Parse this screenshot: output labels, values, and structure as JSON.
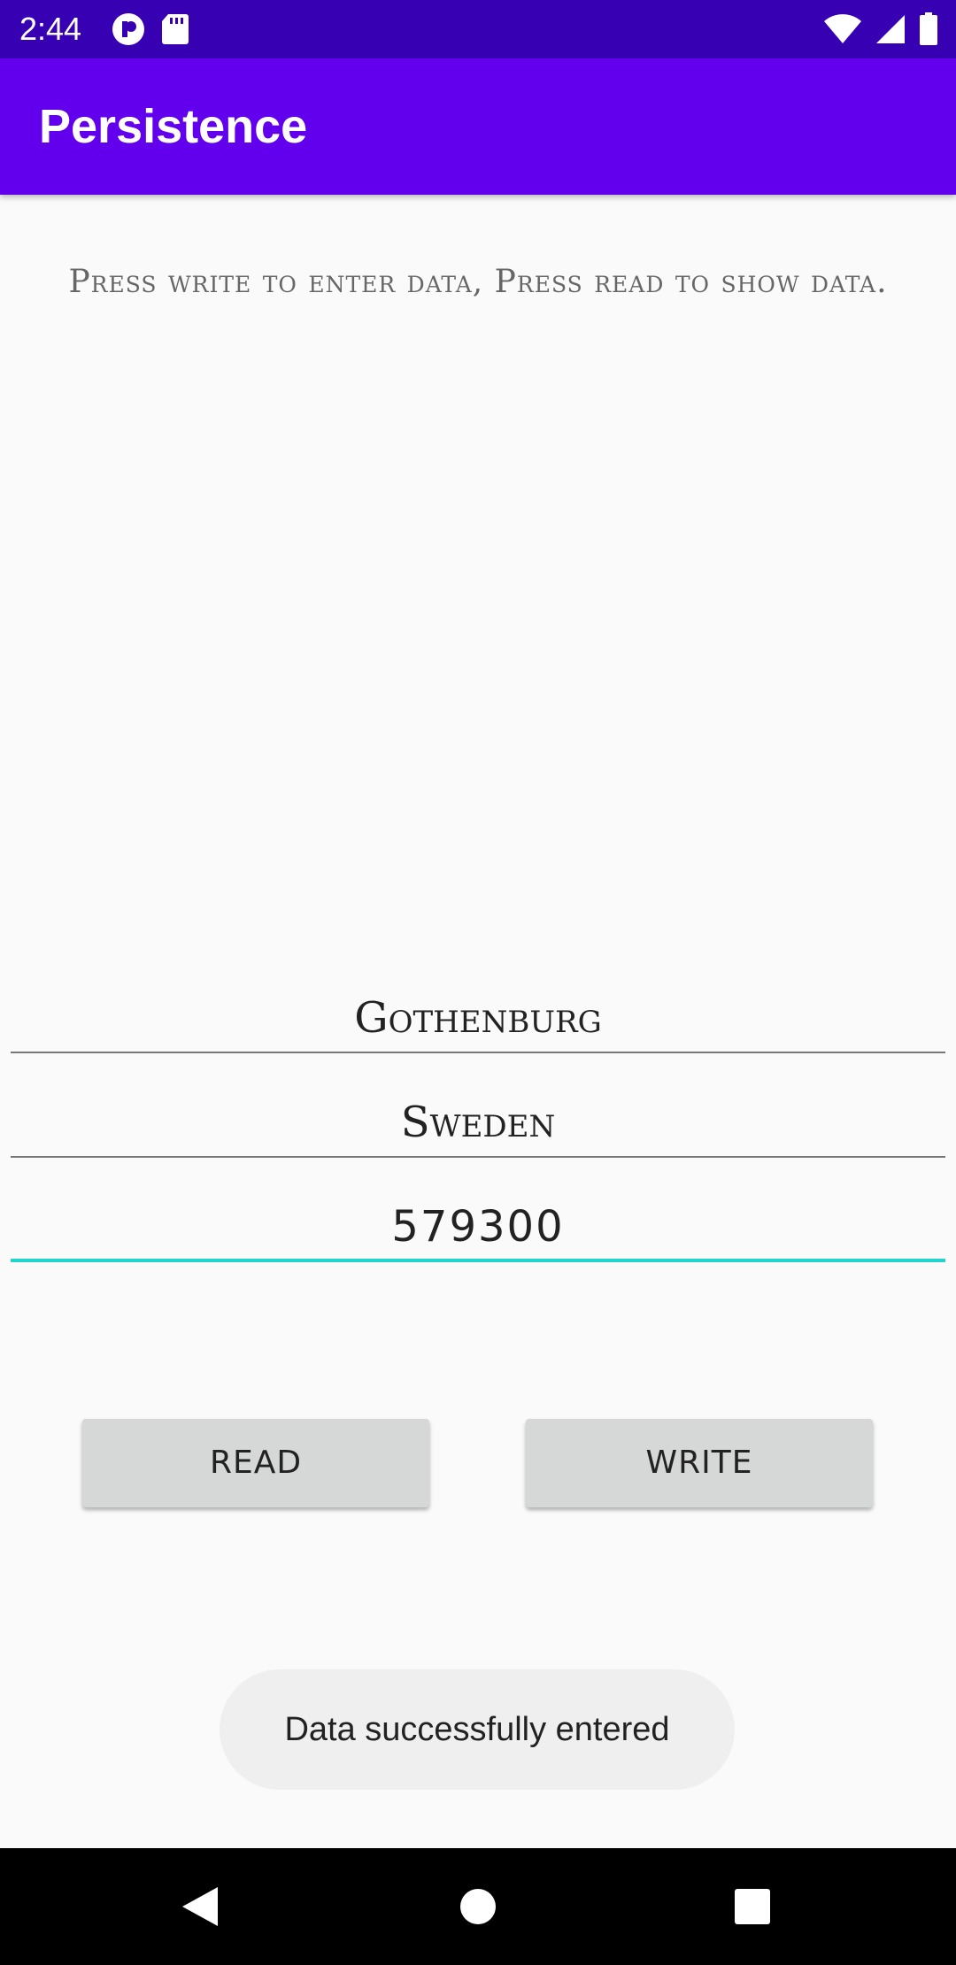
{
  "status_bar": {
    "time": "2:44",
    "left_icons": [
      "notification-app-icon",
      "sd-card-icon"
    ],
    "right_icons": [
      "wifi-icon",
      "signal-icon",
      "battery-icon"
    ]
  },
  "app_bar": {
    "title": "Persistence"
  },
  "instruction": "Press write to enter data, Press read to show data.",
  "fields": {
    "city": "Gothenburg",
    "country": "Sweden",
    "population": "579300"
  },
  "buttons": {
    "read": "READ",
    "write": "WRITE"
  },
  "toast": "Data successfully entered",
  "nav_bar": {
    "icons": [
      "back-icon",
      "home-icon",
      "recents-icon"
    ]
  },
  "colors": {
    "status_bar": "#3700b3",
    "app_bar": "#6200ee",
    "focus_accent": "#1fd6c8",
    "button": "#d6d7d7"
  }
}
